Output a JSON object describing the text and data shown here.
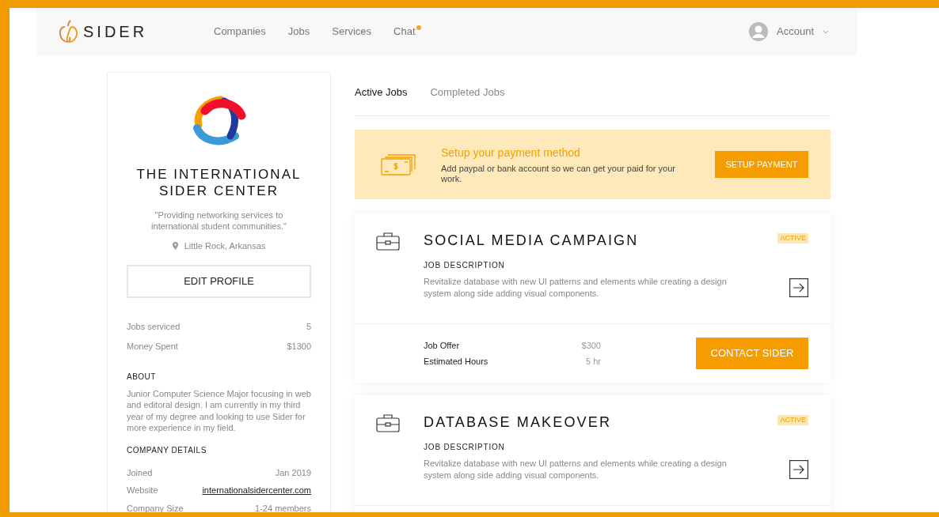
{
  "nav": {
    "brand": "SIDER",
    "links": [
      {
        "label": "Companies",
        "badge": false
      },
      {
        "label": "Jobs",
        "badge": false
      },
      {
        "label": "Services",
        "badge": false
      },
      {
        "label": "Chat",
        "badge": true
      }
    ],
    "account": "Account"
  },
  "profile": {
    "name": "THE INTERNATIONAL SIDER CENTER",
    "tagline": "\"Providing networking services to international student communities.\"",
    "location": "Little Rock, Arkansas",
    "edit_button": "EDIT PROFILE",
    "stats": [
      {
        "label": "Jobs serviced",
        "value": "5"
      },
      {
        "label": "Money Spent",
        "value": "$1300"
      }
    ],
    "about_heading": "ABOUT",
    "about": " Junior Computer Science Major focusing in web and editoral design. I am currently in my third year of my degree and looking to use Sider for more experience in my field.",
    "details_heading": "COMPANY DETAILS",
    "details": [
      {
        "label": "Joined",
        "value": "Jan 2019",
        "kind": "text"
      },
      {
        "label": "Website",
        "value": "internationalsidercenter.com",
        "kind": "link"
      },
      {
        "label": "Company Size",
        "value": "1-24 members",
        "kind": "text"
      }
    ]
  },
  "tabs": [
    {
      "label": "Active Jobs",
      "selected": true
    },
    {
      "label": "Completed Jobs",
      "selected": false
    }
  ],
  "payment_banner": {
    "title": "Setup your payment method",
    "text": "Add paypal or bank account so we can get your paid for your work.",
    "button": "SETUP PAYMENT"
  },
  "jobs": [
    {
      "title": "SOCIAL MEDIA CAMPAIGN",
      "status": "ACTIVE",
      "desc_heading": "JOB DESCRIPTION",
      "description": "Revitalize database with new UI patterns and elements while creating a design system along side adding visual components.",
      "offer": [
        {
          "label": "Job Offer",
          "value": "$300"
        },
        {
          "label": "Estimated Hours",
          "value": "5 hr"
        }
      ],
      "button": "CONTACT SIDER"
    },
    {
      "title": "DATABASE MAKEOVER",
      "status": "ACTIVE",
      "desc_heading": "JOB DESCRIPTION",
      "description": "Revitalize database with new UI patterns and elements while creating a design system along side adding visual components."
    }
  ]
}
